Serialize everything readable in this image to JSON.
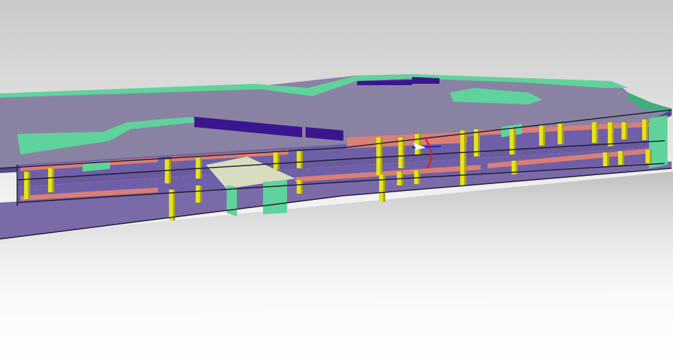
{
  "viewport": {
    "background": {
      "top": "#c9c9c9",
      "mid": "#f2f2f2",
      "bottom": "#ffffff"
    }
  },
  "model": {
    "colors": {
      "roof": "#8a82a3",
      "roof_edge": "#7a7394",
      "slab": "#6a5a9e",
      "slab_dark": "#55478a",
      "facade": "#7a6aa8",
      "floor_fill": "#6e5fa8",
      "mint": "#5fd39b",
      "mint_dark": "#3fae7c",
      "beam": "#d97f75",
      "column": "#e6e21a",
      "column_dark": "#a7a40c",
      "dark_purple": "#3b1590",
      "outline": "#1c1a2e",
      "ramp": "#d8dcc0"
    }
  },
  "gizmo": {
    "colors": {
      "x": "#e02020",
      "y": "#1a2fd0",
      "z": "#ffffff"
    }
  }
}
